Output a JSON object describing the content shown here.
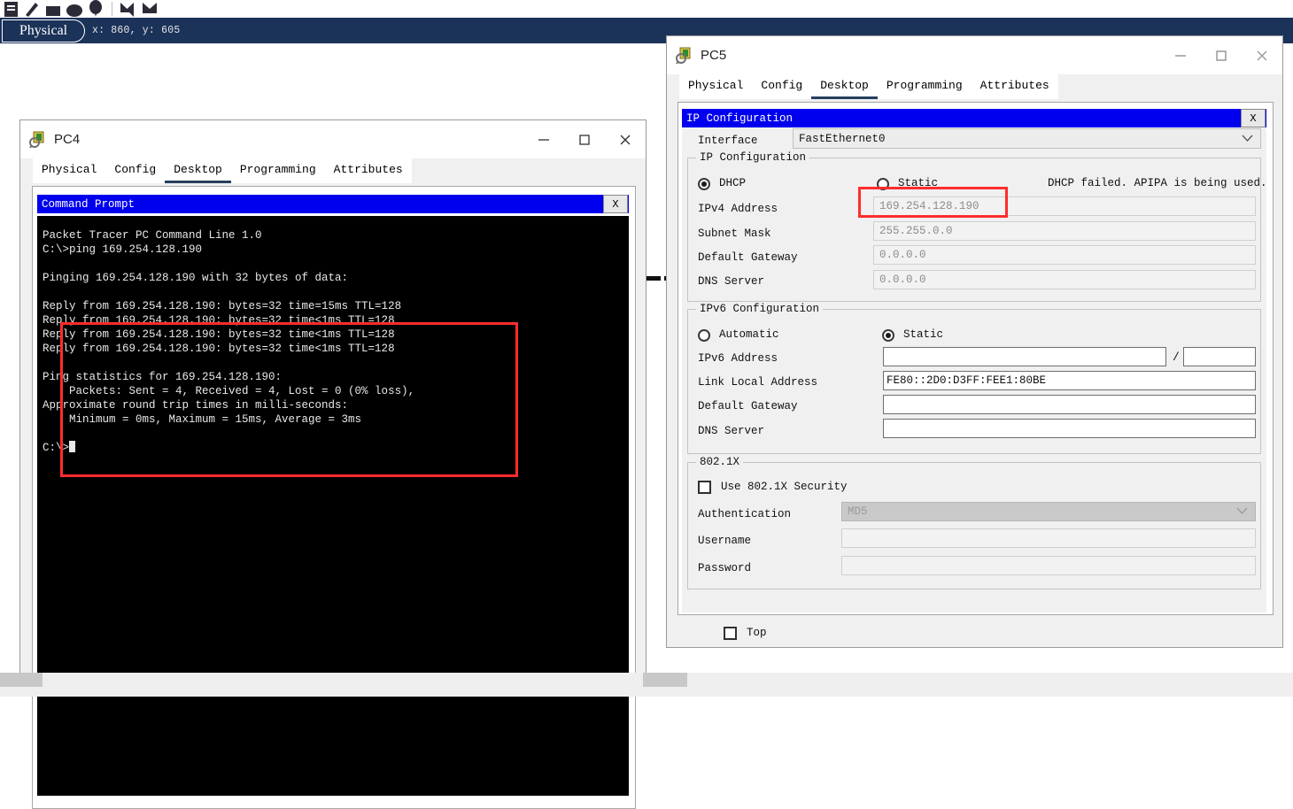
{
  "toolbar": {
    "icons": [
      "note-icon",
      "pencil-icon",
      "eraser-icon",
      "ellipse-icon",
      "balloon-icon",
      "add-simple-pdu-icon",
      "add-complex-pdu-icon"
    ]
  },
  "statusbar": {
    "view_tab_label": "Physical",
    "coordinates": "x: 860, y: 605"
  },
  "pc4_window": {
    "title": "PC4",
    "icon": "device-pc-icon",
    "controls": {
      "minimize": "minimize-icon",
      "maximize": "maximize-icon",
      "close": "close-icon"
    },
    "tabs": [
      {
        "label": "Physical",
        "active": false
      },
      {
        "label": "Config",
        "active": false
      },
      {
        "label": "Desktop",
        "active": true
      },
      {
        "label": "Programming",
        "active": false
      },
      {
        "label": "Attributes",
        "active": false
      }
    ],
    "command_prompt": {
      "title": "Command Prompt",
      "close_label": "X",
      "lines": [
        "Packet Tracer PC Command Line 1.0",
        "C:\\>ping 169.254.128.190",
        "",
        "Pinging 169.254.128.190 with 32 bytes of data:",
        "",
        "Reply from 169.254.128.190: bytes=32 time=15ms TTL=128",
        "Reply from 169.254.128.190: bytes=32 time<1ms TTL=128",
        "Reply from 169.254.128.190: bytes=32 time<1ms TTL=128",
        "Reply from 169.254.128.190: bytes=32 time<1ms TTL=128",
        "",
        "Ping statistics for 169.254.128.190:",
        "    Packets: Sent = 4, Received = 4, Lost = 0 (0% loss),",
        "Approximate round trip times in milli-seconds:",
        "    Minimum = 0ms, Maximum = 15ms, Average = 3ms",
        "",
        "C:\\>"
      ]
    }
  },
  "pc5_window": {
    "title": "PC5",
    "icon": "device-pc-icon",
    "controls": {
      "minimize": "minimize-icon",
      "maximize": "maximize-icon",
      "close": "close-icon"
    },
    "tabs": [
      {
        "label": "Physical",
        "active": false
      },
      {
        "label": "Config",
        "active": false
      },
      {
        "label": "Desktop",
        "active": true
      },
      {
        "label": "Programming",
        "active": false
      },
      {
        "label": "Attributes",
        "active": false
      }
    ],
    "ip_config": {
      "title": "IP Configuration",
      "close_label": "X",
      "interface_label": "Interface",
      "interface_value": "FastEthernet0",
      "ipv4": {
        "group_title": "IP Configuration",
        "dhcp_label": "DHCP",
        "dhcp_selected": true,
        "static_label": "Static",
        "static_selected": false,
        "status_message": "DHCP failed. APIPA is being used.",
        "rows": [
          {
            "label": "IPv4 Address",
            "value": "169.254.128.190"
          },
          {
            "label": "Subnet Mask",
            "value": "255.255.0.0"
          },
          {
            "label": "Default Gateway",
            "value": "0.0.0.0"
          },
          {
            "label": "DNS Server",
            "value": "0.0.0.0"
          }
        ]
      },
      "ipv6": {
        "group_title": "IPv6 Configuration",
        "automatic_label": "Automatic",
        "automatic_selected": false,
        "static_label": "Static",
        "static_selected": true,
        "address_label": "IPv6 Address",
        "address_value": "",
        "prefix_separator": "/",
        "prefix_value": "",
        "link_local_label": "Link Local Address",
        "link_local_value": "FE80::2D0:D3FF:FEE1:80BE",
        "gateway_label": "Default Gateway",
        "gateway_value": "",
        "dns_label": "DNS Server",
        "dns_value": ""
      },
      "dot1x": {
        "group_title": "802.1X",
        "use_security_label": "Use 802.1X Security",
        "use_security_checked": false,
        "authentication_label": "Authentication",
        "authentication_value": "MD5",
        "username_label": "Username",
        "username_value": "",
        "password_label": "Password",
        "password_value": ""
      }
    },
    "top_checkbox_label": "Top",
    "top_checkbox_checked": false
  },
  "annotations": {
    "accent_color": "#ff2d2d",
    "highlight_terminal": "ping output block",
    "highlight_ipv4": "IPv4 address field"
  }
}
